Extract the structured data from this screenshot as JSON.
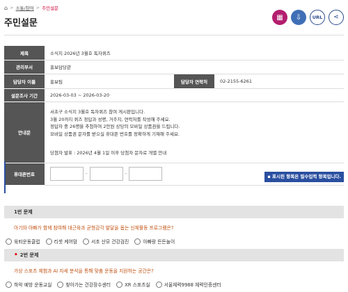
{
  "breadcrumb": {
    "home_icon": "home-icon",
    "items": [
      "소통/참여",
      "주민설문"
    ],
    "sep": ">"
  },
  "page_title": "주민설문",
  "actions": {
    "qr_icon": "qr-icon",
    "download_icon": "download-icon",
    "url_label": "URL",
    "share_icon": "share-icon"
  },
  "info": {
    "title_label": "제목",
    "title_value": "소식지 2026년 3월호 독자퀴즈",
    "dept_label": "관리부서",
    "dept_value": "홍보담당관",
    "manager_label": "담당자 이름",
    "manager_value": "홍보팀",
    "contact_label": "담당자 연락처",
    "contact_value": "02-2155-6261",
    "period_label": "설문조사 기간",
    "period_value": "2026-03-03 ~ 2026-03-20",
    "guide_label": "안내문",
    "guide_lines": [
      "서초구 소식지 3월호 독자퀴즈 참여 게시판입니다.",
      "3월 20까지 퀴즈 정답과 성명, 거주지, 연락처를 작성해 주세요.",
      "정답자 중 26명을 추첨하여 2만원 상당의 모바일 상품권을 드립니다.",
      "모바일 상품권 문자를 받으실 휴대폰 번호를 정확하게 기재해 주세요."
    ],
    "guide_note": "당첨자 발표 : 2026년 4월 1일 이후 당첨자 문자로 개별 안내",
    "phone_label": "휴대폰번호",
    "phone_sep": "-"
  },
  "required_note": "▪ 표시된 항목은 필수입력 항목입니다.",
  "questions": [
    {
      "header": "1번 문제",
      "required_mark": "",
      "text": "아기와 아빠가 함께 참여해 대근육과 균형감각 발달을 돕는 신체활동 프로그램은?",
      "options": [
        "육퇴운동클럽",
        "리셋 케어맘",
        "서초 산모 건강검진",
        "아빠랑 든든놀이"
      ]
    },
    {
      "header": "2번 문제",
      "required_mark": "•",
      "text": "가상 스포츠 체험과 AI 자세 분석을 통해 맞춤 운동을 지원하는 공간은?",
      "options": [
        "하악 예방 운동교실",
        "찾아가는 건강장수센터",
        "XR 스포츠실",
        "서울체력9988 체력인증센터"
      ]
    }
  ],
  "colors": {
    "header_bg": "#555555",
    "accent_blue": "#2a4fa0",
    "question_text": "#c05010",
    "qr_magenta": "#b31e6e"
  }
}
